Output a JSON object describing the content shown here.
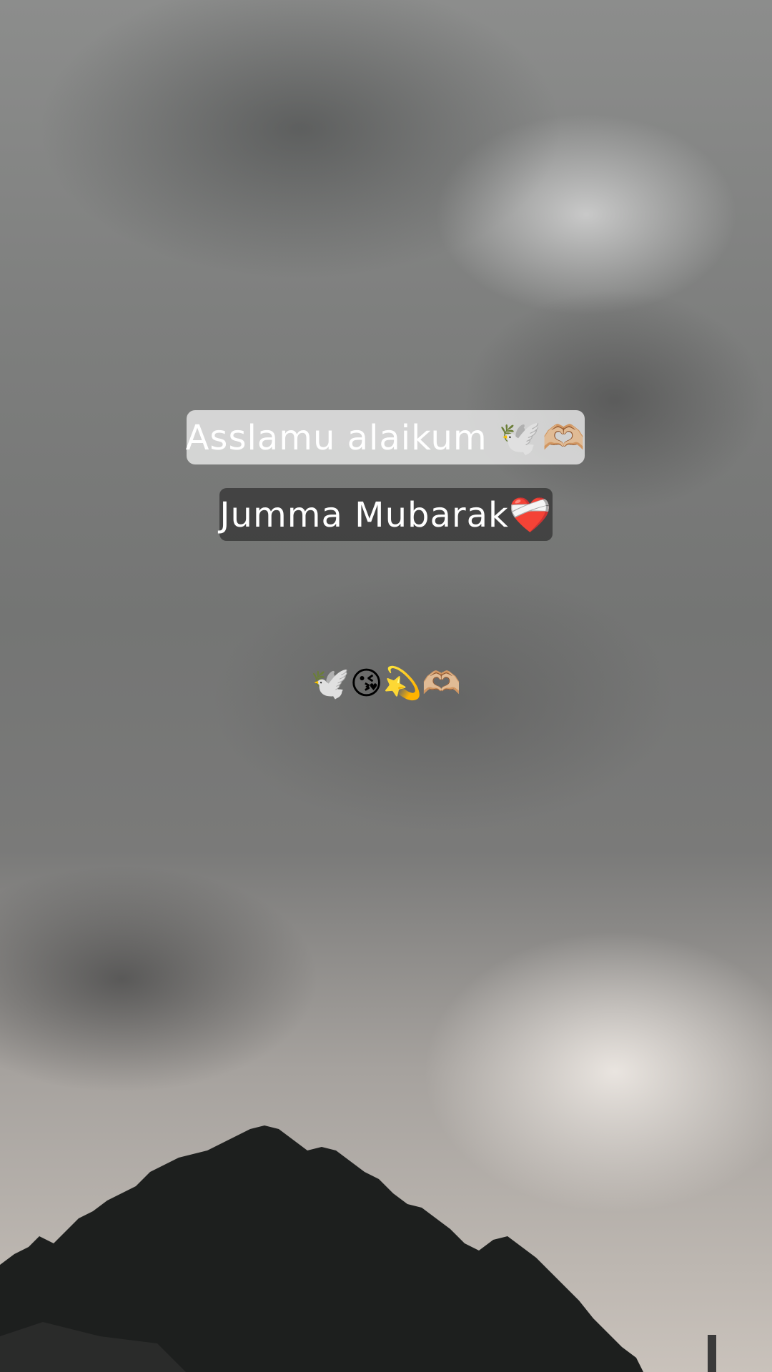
{
  "captions": {
    "line1": "Asslamu alaikum 🕊️🫶🏼",
    "line2": "Jumma Mubarak❤️‍🩹",
    "emoji_line": "🕊️😘💫🫶🏼"
  },
  "colors": {
    "sticker1_bg": "#eeeeee",
    "sticker2_bg": "#3a3a3a",
    "text": "#ffffff"
  }
}
